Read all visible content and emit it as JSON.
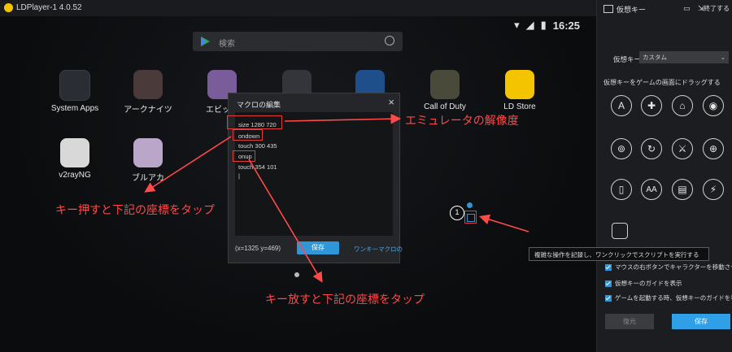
{
  "window": {
    "title": "LDPlayer-1 4.0.52"
  },
  "status_bar": {
    "time": "16:25"
  },
  "search": {
    "placeholder": "検索"
  },
  "apps": [
    {
      "label": "System Apps",
      "color": "#2a2d33"
    },
    {
      "label": "アークナイツ",
      "color": "#4a3b3a"
    },
    {
      "label": "エビック",
      "color": "#7a5c9a"
    },
    {
      "label": "",
      "color": "#33353a"
    },
    {
      "label": "",
      "color": "#1f4f8a"
    },
    {
      "label": "Call of Duty",
      "color": "#4a4a3a"
    },
    {
      "label": "LD Store",
      "color": "#f5c400"
    },
    {
      "label": "v2rayNG",
      "color": "#d8d8d8"
    },
    {
      "label": "ブルアカ",
      "color": "#b9a6c8"
    }
  ],
  "macro_dialog": {
    "title": "マクロの編集",
    "lines": [
      "size 1280 720",
      "ondown",
      "touch 300 435",
      "onup",
      "touch 354 101"
    ],
    "coords": "(x=1325  y=469)",
    "save_label": "保存",
    "one_click_label": "ワンキーマクロの"
  },
  "annotations": {
    "resolution": "エミュレータの解像度",
    "press": "キー押すと下記の座標をタップ",
    "release": "キー放すと下記の座標をタップ",
    "marker_number": "1"
  },
  "panel": {
    "title": "仮想キー",
    "exit_label": "終了する",
    "vk_label": "仮想キー",
    "vk_select_value": "カスタム",
    "drag_hint": "仮想キーをゲームの画面にドラッグする",
    "keys": [
      "A",
      "✚",
      "⌂",
      "◉",
      "⊚",
      "↻",
      "⚔",
      "⊕",
      "▯",
      "AA",
      "▤",
      "⚡"
    ],
    "tooltip": "複雑な操作を記録し、ワンクリックでスクリプトを実行する",
    "checkboxes": [
      "マウスの右ボタンでキャラクターを移動させる",
      "仮想キーのガイドを表示",
      "ゲームを起動する時、仮想キーのガイドを表示"
    ],
    "reset_label": "復元",
    "save_label": "保存"
  },
  "colors": {
    "accent": "#2f96d8",
    "annotation": "#ff4a4a"
  }
}
